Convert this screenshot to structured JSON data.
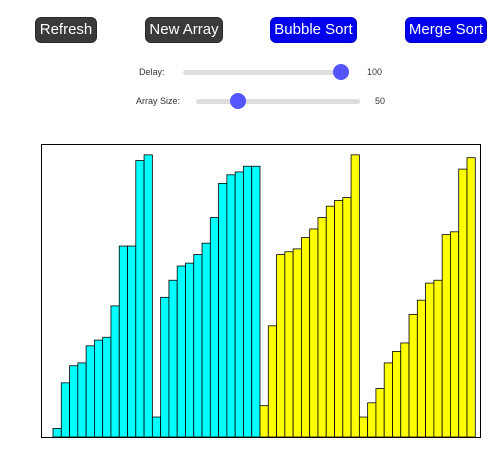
{
  "toolbar": {
    "refresh_label": "Refresh",
    "new_array_label": "New Array",
    "bubble_sort_label": "Bubble Sort",
    "merge_sort_label": "Merge Sort"
  },
  "controls": {
    "delay": {
      "label": "Delay:",
      "value": "100",
      "level": 0.95
    },
    "array_size": {
      "label": "Array Size:",
      "value": "50",
      "level": 0.27
    }
  },
  "colors": {
    "dark_button": "#3a3a3a",
    "blue_button": "#0000ee",
    "slider_thumb": "#5555ff",
    "unsorted_bar": "#00ffff",
    "sorted_bar": "#ffff00"
  },
  "chart_data": {
    "type": "bar",
    "max_value": 100,
    "values": [
      3,
      19,
      25,
      26,
      32,
      34,
      35,
      46,
      67,
      67,
      97,
      99,
      7,
      49,
      55,
      60,
      61,
      64,
      68,
      77,
      89,
      92,
      93,
      95,
      95,
      11,
      39,
      64,
      65,
      66,
      70,
      73,
      77,
      81,
      83,
      84,
      99,
      7,
      12,
      17,
      26,
      30,
      33,
      43,
      48,
      54,
      55,
      71,
      72,
      94,
      98
    ],
    "colors": [
      "cyan",
      "cyan",
      "cyan",
      "cyan",
      "cyan",
      "cyan",
      "cyan",
      "cyan",
      "cyan",
      "cyan",
      "cyan",
      "cyan",
      "cyan",
      "cyan",
      "cyan",
      "cyan",
      "cyan",
      "cyan",
      "cyan",
      "cyan",
      "cyan",
      "cyan",
      "cyan",
      "cyan",
      "cyan",
      "yellow",
      "yellow",
      "yellow",
      "yellow",
      "yellow",
      "yellow",
      "yellow",
      "yellow",
      "yellow",
      "yellow",
      "yellow",
      "yellow",
      "yellow",
      "yellow",
      "yellow",
      "yellow",
      "yellow",
      "yellow",
      "yellow",
      "yellow",
      "yellow",
      "yellow",
      "yellow",
      "yellow",
      "yellow",
      "yellow"
    ]
  }
}
